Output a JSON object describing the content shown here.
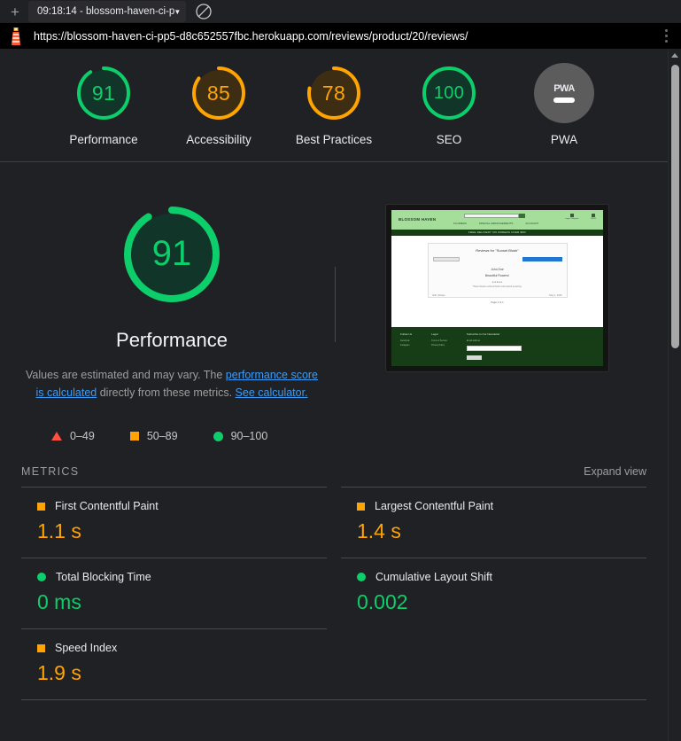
{
  "browser": {
    "new_tab_label": "+",
    "tab_title": "09:18:14 - blossom-haven-ci-p",
    "tab_caret": "▼",
    "block_icon_name": "no-entry-icon",
    "url": "https://blossom-haven-ci-pp5-d8c652557fbc.herokuapp.com/reviews/product/20/reviews/",
    "menu_icon_name": "kebab-menu-icon"
  },
  "colors": {
    "green": "#0cce6b",
    "orange": "#ffa400",
    "red": "#ff4e42",
    "gray": "#5c5c5c",
    "link": "#3b9bf5",
    "bg": "#202124"
  },
  "scores": [
    {
      "label": "Performance",
      "value": "91",
      "score": 91,
      "status": "pass"
    },
    {
      "label": "Accessibility",
      "value": "85",
      "score": 85,
      "status": "average"
    },
    {
      "label": "Best Practices",
      "value": "78",
      "score": 78,
      "status": "average"
    },
    {
      "label": "SEO",
      "value": "100",
      "score": 100,
      "status": "pass"
    },
    {
      "label": "PWA",
      "value": "PWA",
      "score": null,
      "status": "null"
    }
  ],
  "category": {
    "gauge_value": "91",
    "gauge_score": 91,
    "title": "Performance",
    "disclaimer_part1": "Values are estimated and may vary. The ",
    "disclaimer_link1": "performance score is calculated",
    "disclaimer_part2": " directly from these metrics. ",
    "disclaimer_link2": "See calculator."
  },
  "thumbnail": {
    "brand": "BLOSSOM HAVEN",
    "search_placeholder": "Search ...",
    "search_button_icon": "search-icon",
    "nav": [
      "FLOWERS",
      "SPECIAL ARRANGEMENTS",
      "ACCOUNT"
    ],
    "account_icon_label": "Login / Register",
    "cart_icon_label": "$0.00",
    "banner": "FREE DELIVERY ON ORDERS OVER $50!",
    "card_title": "Reviews for \"Sunset Blush\"",
    "back_button": "< Back to Product",
    "primary_button": "Leave a Review on this Item",
    "review_author": "John Doe",
    "review_title": "Beautiful Flowers!",
    "review_rating": "★★★★★",
    "review_body": "These flowers arrived fresh and looked amazing.",
    "review_meta": "Edit | Delete",
    "review_date": "May 1, 2025",
    "pager": "Page 1 of 1",
    "footer_col1_title": "Follow Us",
    "footer_col1_items": [
      "Facebook",
      "Instagram"
    ],
    "footer_col2_title": "Legal",
    "footer_col2_items": [
      "Terms of Service",
      "Privacy Policy"
    ],
    "footer_col3_title": "Subscribe to Our Newsletter",
    "footer_col3_label": "Email address",
    "footer_input_value": "",
    "footer_button": "Subscribe"
  },
  "legend": [
    {
      "shape": "triangle",
      "label": "0–49",
      "color": "#ff4e42"
    },
    {
      "shape": "square",
      "label": "50–89",
      "color": "#ffa400"
    },
    {
      "shape": "circle",
      "label": "90–100",
      "color": "#0cce6b"
    }
  ],
  "metrics_section": {
    "title": "METRICS",
    "expand_view": "Expand view"
  },
  "metrics": [
    {
      "name": "First Contentful Paint",
      "value": "1.1 s",
      "status": "average",
      "shape": "square"
    },
    {
      "name": "Largest Contentful Paint",
      "value": "1.4 s",
      "status": "average",
      "shape": "square"
    },
    {
      "name": "Total Blocking Time",
      "value": "0 ms",
      "status": "pass",
      "shape": "circle"
    },
    {
      "name": "Cumulative Layout Shift",
      "value": "0.002",
      "status": "pass",
      "shape": "circle"
    },
    {
      "name": "Speed Index",
      "value": "1.9 s",
      "status": "average",
      "shape": "square"
    }
  ],
  "scrollbar": {
    "up_arrow_icon": "scroll-up-arrow-icon"
  }
}
